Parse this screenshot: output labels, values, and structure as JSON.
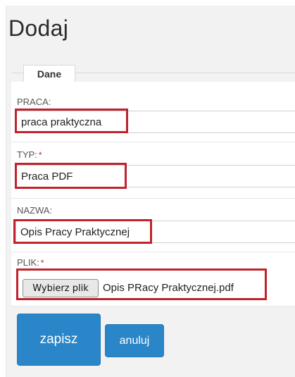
{
  "page": {
    "title": "Dodaj"
  },
  "fieldset": {
    "legend": "Dane"
  },
  "fields": {
    "praca": {
      "label": "PRACA:",
      "value": "praca praktyczna"
    },
    "typ": {
      "label": "TYP:",
      "required_mark": "*",
      "value": "Praca PDF"
    },
    "nazwa": {
      "label": "NAZWA:",
      "value": "Opis Pracy Praktycznej"
    },
    "plik": {
      "label": "PLIK:",
      "required_mark": "*",
      "button_label": "Wybierz plik",
      "file_name": "Opis PRacy Praktycznej.pdf"
    }
  },
  "actions": {
    "save_label": "zapisz",
    "cancel_label": "anuluj"
  },
  "colors": {
    "primary": "#2a86c8",
    "highlight": "#c0232d",
    "required": "#cc2222"
  }
}
